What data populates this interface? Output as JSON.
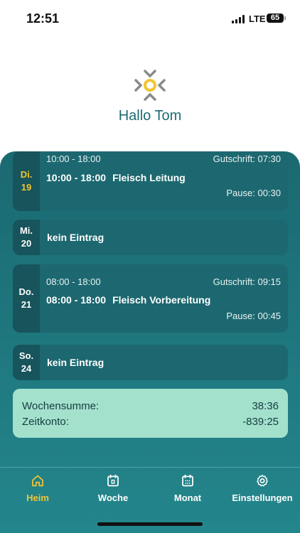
{
  "status": {
    "time": "12:51",
    "network": "LTE",
    "battery": "65"
  },
  "header": {
    "greeting": "Hallo Tom"
  },
  "days": [
    {
      "weekday": "Di.",
      "day": "19",
      "today": true,
      "planned": "10:00 - 18:00",
      "credit": "Gutschrift: 07:30",
      "shift_time": "10:00 - 18:00",
      "department": "Fleisch Leitung",
      "pause": "Pause: 00:30"
    },
    {
      "weekday": "Mi.",
      "day": "20",
      "empty_label": "kein Eintrag"
    },
    {
      "weekday": "Do.",
      "day": "21",
      "planned": "08:00 - 18:00",
      "credit": "Gutschrift: 09:15",
      "shift_time": "08:00 - 18:00",
      "department": "Fleisch Vorbereitung",
      "pause": "Pause: 00:45"
    },
    {
      "weekday": "So.",
      "day": "24",
      "empty_label": "kein Eintrag"
    }
  ],
  "summary": {
    "week_label": "Wochensumme:",
    "week_value": "38:36",
    "account_label": "Zeitkonto:",
    "account_value": "-839:25"
  },
  "tabs": [
    {
      "label": "Heim",
      "icon": "home-icon",
      "active": true
    },
    {
      "label": "Woche",
      "icon": "calendar-week-icon"
    },
    {
      "label": "Monat",
      "icon": "calendar-month-icon"
    },
    {
      "label": "Einstellungen",
      "icon": "gear-icon"
    }
  ],
  "colors": {
    "accent": "#f4c430",
    "primary": "#1d6b73",
    "summary_bg": "#a3e1cd"
  }
}
